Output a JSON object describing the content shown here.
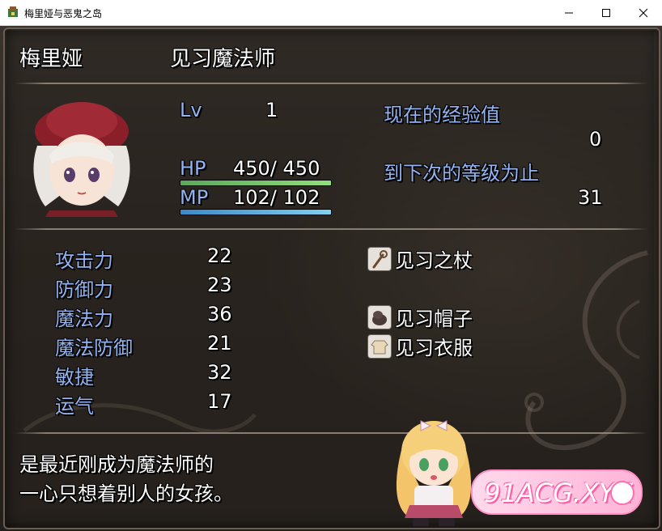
{
  "window": {
    "title": "梅里娅与恶鬼之岛",
    "minimize_icon": "minimize-icon",
    "maximize_icon": "maximize-icon",
    "close_icon": "close-icon"
  },
  "character": {
    "name": "梅里娅",
    "class": "见习魔法师",
    "level_label": "Lv",
    "level": "1",
    "hp_label": "HP",
    "hp_value": "450/ 450",
    "hp_fraction": 1.0,
    "mp_label": "MP",
    "mp_value": "102/ 102",
    "mp_fraction": 1.0,
    "exp_label": "现在的经验值",
    "exp_value": "0",
    "next_label": "到下次的等级为止",
    "next_value": "31"
  },
  "stats": [
    {
      "label": "攻击力",
      "value": "22"
    },
    {
      "label": "防御力",
      "value": "23"
    },
    {
      "label": "魔法力",
      "value": "36"
    },
    {
      "label": "魔法防御",
      "value": "21"
    },
    {
      "label": "敏捷",
      "value": "32"
    },
    {
      "label": "运气",
      "value": "17"
    }
  ],
  "equipment": [
    {
      "name": "见习之杖",
      "icon": "staff-icon"
    },
    {
      "name": "见习帽子",
      "icon": "hat-icon"
    },
    {
      "name": "见习衣服",
      "icon": "clothes-icon"
    }
  ],
  "description": {
    "line1": "是最近刚成为魔法师的",
    "line2": "一心只想着别人的女孩。"
  },
  "watermark": {
    "text": "91ACG.XYZ"
  },
  "colors": {
    "label_blue": "#93b4f2",
    "hp_gauge": "#6fc26a",
    "mp_gauge": "#4fa8d8"
  }
}
